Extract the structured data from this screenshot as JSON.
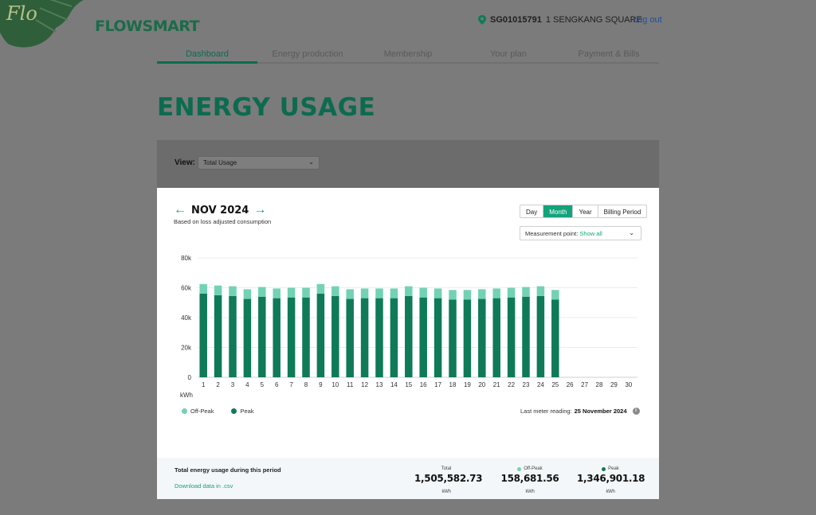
{
  "header": {
    "logo_text": "Flo",
    "brand": "FLOWSMART",
    "site_code": "SG01015791",
    "site_address": "1 SENGKANG SQUARE",
    "logout": "Log out"
  },
  "nav": {
    "tabs": [
      {
        "label": "Dashboard"
      },
      {
        "label": "Energy production"
      },
      {
        "label": "Membership"
      },
      {
        "label": "Your plan"
      },
      {
        "label": "Payment & Bills"
      }
    ],
    "active_index": 0
  },
  "page_title": "ENERGY USAGE",
  "view": {
    "label": "View:",
    "selected": "Total Usage"
  },
  "period": {
    "label": "NOV 2024",
    "subtitle": "Based on loss adjusted consumption"
  },
  "granularity": {
    "options": [
      "Day",
      "Month",
      "Year",
      "Billing Period"
    ],
    "active_index": 1
  },
  "measurement": {
    "label": "Measurement point:",
    "value": "Show all"
  },
  "colors": {
    "peak": "#0f7a58",
    "off_peak": "#72d2b4",
    "accent": "#12a37a"
  },
  "chart_data": {
    "type": "bar",
    "stacked": true,
    "ylabel": "kWh",
    "ylim": [
      0,
      80000
    ],
    "yticks": [
      0,
      20000,
      40000,
      60000,
      80000
    ],
    "ytick_labels": [
      "0",
      "20k",
      "40k",
      "60k",
      "80k"
    ],
    "categories": [
      "1",
      "2",
      "3",
      "4",
      "5",
      "6",
      "7",
      "8",
      "9",
      "10",
      "11",
      "12",
      "13",
      "14",
      "15",
      "16",
      "17",
      "18",
      "19",
      "20",
      "21",
      "22",
      "23",
      "24",
      "25",
      "26",
      "27",
      "28",
      "29",
      "30"
    ],
    "series": [
      {
        "name": "Peak",
        "color": "#0f7a58",
        "values": [
          56000,
          55000,
          54500,
          52500,
          54000,
          53000,
          53500,
          53500,
          56000,
          54500,
          52500,
          53000,
          53000,
          53000,
          54500,
          53500,
          53000,
          52000,
          52000,
          52500,
          53000,
          53500,
          54000,
          54500,
          52000,
          null,
          null,
          null,
          null,
          null
        ]
      },
      {
        "name": "Off-Peak",
        "color": "#72d2b4",
        "values": [
          6500,
          6500,
          6500,
          6500,
          6500,
          6500,
          6500,
          6500,
          6500,
          6500,
          6500,
          6500,
          6500,
          6500,
          6500,
          6500,
          6500,
          6500,
          6500,
          6500,
          6500,
          6500,
          6500,
          6500,
          6500,
          null,
          null,
          null,
          null,
          null
        ]
      }
    ],
    "legend": [
      "Off-Peak",
      "Peak"
    ],
    "grid": true
  },
  "last_reading": {
    "label": "Last meter reading:",
    "value": "25 November 2024"
  },
  "totals": {
    "title": "Total energy usage during this period",
    "download": "Download data in .csv",
    "total_label": "Total",
    "total_value": "1,505,582.73",
    "offpeak_label": "Off-Peak",
    "offpeak_value": "158,681.56",
    "peak_label": "Peak",
    "peak_value": "1,346,901.18",
    "unit": "kWh"
  }
}
